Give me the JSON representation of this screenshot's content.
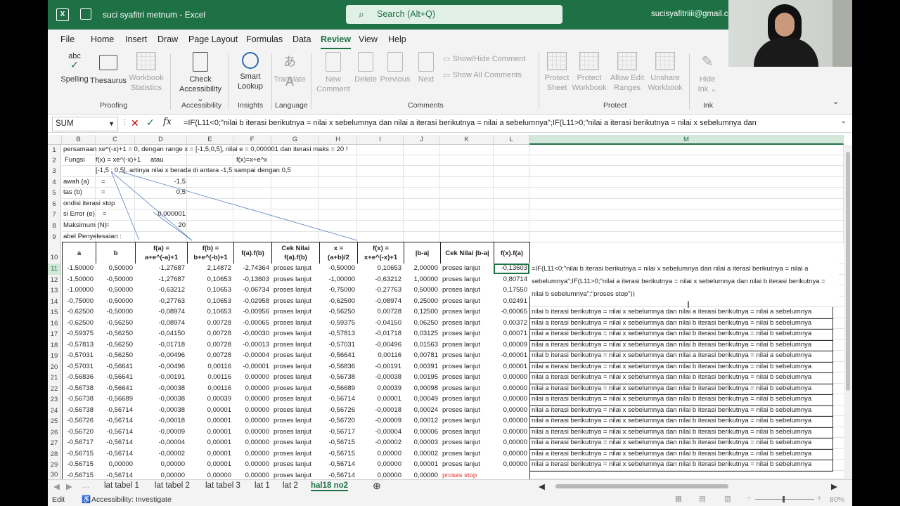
{
  "title_bar": {
    "doc_title": "suci syafitri metnum  -  Excel",
    "search_placeholder": "Search (Alt+Q)",
    "user": "sucisyafitriiii@gmail.com"
  },
  "menu": {
    "tabs": [
      "File",
      "Home",
      "Insert",
      "Draw",
      "Page Layout",
      "Formulas",
      "Data",
      "Review",
      "View",
      "Help"
    ],
    "active": "Review"
  },
  "ribbon": {
    "spelling": "Spelling",
    "thesaurus": "Thesaurus",
    "workbook_stats_1": "Workbook",
    "workbook_stats_2": "Statistics",
    "proofing": "Proofing",
    "check_acc_1": "Check",
    "check_acc_2": "Accessibility ⌄",
    "accessibility": "Accessibility",
    "smart_1": "Smart",
    "smart_2": "Lookup",
    "insights": "Insights",
    "translate": "Translate",
    "language": "Language",
    "new_1": "New",
    "new_2": "Comment",
    "delete": "Delete",
    "previous": "Previous",
    "next": "Next",
    "show_hide": "Show/Hide Comment",
    "show_all": "Show All Comments",
    "comments": "Comments",
    "protect_sheet_1": "Protect",
    "protect_sheet_2": "Sheet",
    "protect_wb_1": "Protect",
    "protect_wb_2": "Workbook",
    "allow_1": "Allow Edit",
    "allow_2": "Ranges",
    "unshare_1": "Unshare",
    "unshare_2": "Workbook",
    "protect": "Protect",
    "hide_ink_1": "Hide",
    "hide_ink_2": "Ink ⌄",
    "ink": "Ink"
  },
  "formula_bar": {
    "name_box": "SUM",
    "formula": "=IF(L11<0;\"nilai b iterasi berikutnya = nilai x sebelumnya dan nilai a iterasi berikutnya = nilai a sebelumnya\";IF(L11>0;\"nilai a iterasi berikutnya = nilai x sebelumnya dan"
  },
  "columns": [
    "B",
    "C",
    "D",
    "E",
    "F",
    "G",
    "H",
    "I",
    "J",
    "K",
    "L",
    "M"
  ],
  "rows": [
    "1",
    "2",
    "3",
    "4",
    "5",
    "6",
    "7",
    "8",
    "9",
    "10",
    "11",
    "12",
    "13",
    "14",
    "15",
    "16",
    "17",
    "18",
    "19",
    "20",
    "21",
    "22",
    "23",
    "24",
    "25",
    "26",
    "27",
    "28",
    "29",
    "30"
  ],
  "top_text": {
    "r1": "persamaan xe^(-x)+1 = 0, dengan range x = [-1,5;0,5], nilai e = 0,000001 dan iterasi maks = 20 !",
    "r2_a": "Fungsi",
    "r2_b": "f(x) = xe^(-x)+1",
    "r2_c": "atau",
    "r2_d": "f(x)=x+e^x",
    "r3": "[-1,5 ; 0,5], artinya nilai x berada di antara -1,5 sampai dengan 0,5",
    "r4_a": "awah (a)",
    "r4_b": "=",
    "r4_c": "-1,5",
    "r5_a": "tas (b)",
    "r5_b": "=",
    "r5_c": "0,5",
    "r6": "ondisi iterasi stop",
    "r7_a": "si Error (e)",
    "r7_b": "=",
    "r7_c": "0,000001",
    "r8_a": "Maksimum (N)",
    "r8_b": "=",
    "r8_c": "20",
    "r9": "abel Penyelesaian :"
  },
  "table_headers": [
    {
      "l1": "a",
      "l2": ""
    },
    {
      "l1": "b",
      "l2": ""
    },
    {
      "l1": "f(a) =",
      "l2": "a+e^(-a)+1"
    },
    {
      "l1": "f(b) =",
      "l2": "b+e^(-b)+1"
    },
    {
      "l1": "f(a).f(b)",
      "l2": ""
    },
    {
      "l1": "Cek Nilai",
      "l2": "f(a).f(b)"
    },
    {
      "l1": "x =",
      "l2": "(a+b)/2"
    },
    {
      "l1": "f(x) =",
      "l2": "x+e^(-x)+1"
    },
    {
      "l1": "|b-a|",
      "l2": ""
    },
    {
      "l1": "Cek Nilai |b-a|",
      "l2": ""
    },
    {
      "l1": "f(x).f(a)",
      "l2": ""
    }
  ],
  "table_rows": [
    [
      "-1,50000",
      "0,50000",
      "-1,27687",
      "2,14872",
      "-2,74364",
      "proses lanjut",
      "-0,50000",
      "0,10653",
      "2,00000",
      "proses lanjut",
      "-0,13603"
    ],
    [
      "-1,50000",
      "-0,50000",
      "-1,27687",
      "0,10653",
      "-0,13603",
      "proses lanjut",
      "-1,00000",
      "-0,63212",
      "1,00000",
      "proses lanjut",
      "0,80714"
    ],
    [
      "-1,00000",
      "-0,50000",
      "-0,63212",
      "0,10653",
      "-0,06734",
      "proses lanjut",
      "-0,75000",
      "-0,27763",
      "0,50000",
      "proses lanjut",
      "0,17550"
    ],
    [
      "-0,75000",
      "-0,50000",
      "-0,27763",
      "0,10653",
      "-0,02958",
      "proses lanjut",
      "-0,62500",
      "-0,08974",
      "0,25000",
      "proses lanjut",
      "0,02491"
    ],
    [
      "-0,62500",
      "-0,50000",
      "-0,08974",
      "0,10653",
      "-0,00956",
      "proses lanjut",
      "-0,56250",
      "0,00728",
      "0,12500",
      "proses lanjut",
      "-0,00065"
    ],
    [
      "-0,62500",
      "-0,56250",
      "-0,08974",
      "0,00728",
      "-0,00065",
      "proses lanjut",
      "-0,59375",
      "-0,04150",
      "0,06250",
      "proses lanjut",
      "0,00372"
    ],
    [
      "-0,59375",
      "-0,56250",
      "-0,04150",
      "0,00728",
      "-0,00030",
      "proses lanjut",
      "-0,57813",
      "-0,01718",
      "0,03125",
      "proses lanjut",
      "0,00071"
    ],
    [
      "-0,57813",
      "-0,56250",
      "-0,01718",
      "0,00728",
      "-0,00013",
      "proses lanjut",
      "-0,57031",
      "-0,00496",
      "0,01563",
      "proses lanjut",
      "0,00009"
    ],
    [
      "-0,57031",
      "-0,56250",
      "-0,00496",
      "0,00728",
      "-0,00004",
      "proses lanjut",
      "-0,56641",
      "0,00116",
      "0,00781",
      "proses lanjut",
      "-0,00001"
    ],
    [
      "-0,57031",
      "-0,56641",
      "-0,00496",
      "0,00116",
      "-0,00001",
      "proses lanjut",
      "-0,56836",
      "-0,00191",
      "0,00391",
      "proses lanjut",
      "0,00001"
    ],
    [
      "-0,56836",
      "-0,56641",
      "-0,00191",
      "0,00116",
      "0,00000",
      "proses lanjut",
      "-0,56738",
      "-0,00038",
      "0,00195",
      "proses lanjut",
      "0,00000"
    ],
    [
      "-0,56738",
      "-0,56641",
      "-0,00038",
      "0,00116",
      "0,00000",
      "proses lanjut",
      "-0,56689",
      "0,00039",
      "0,00098",
      "proses lanjut",
      "0,00000"
    ],
    [
      "-0,56738",
      "-0,56689",
      "-0,00038",
      "0,00039",
      "0,00000",
      "proses lanjut",
      "-0,56714",
      "0,00001",
      "0,00049",
      "proses lanjut",
      "0,00000"
    ],
    [
      "-0,56738",
      "-0,56714",
      "-0,00038",
      "0,00001",
      "0,00000",
      "proses lanjut",
      "-0,56726",
      "-0,00018",
      "0,00024",
      "proses lanjut",
      "0,00000"
    ],
    [
      "-0,56726",
      "-0,56714",
      "-0,00018",
      "0,00001",
      "0,00000",
      "proses lanjut",
      "-0,56720",
      "-0,00009",
      "0,00012",
      "proses lanjut",
      "0,00000"
    ],
    [
      "-0,56720",
      "-0,56714",
      "-0,00009",
      "0,00001",
      "0,00000",
      "proses lanjut",
      "-0,56717",
      "-0,00004",
      "0,00006",
      "proses lanjut",
      "0,00000"
    ],
    [
      "-0,56717",
      "-0,56714",
      "-0,00004",
      "0,00001",
      "0,00000",
      "proses lanjut",
      "-0,56715",
      "-0,00002",
      "0,00003",
      "proses lanjut",
      "0,00000"
    ],
    [
      "-0,56715",
      "-0,56714",
      "-0,00002",
      "0,00001",
      "0,00000",
      "proses lanjut",
      "-0,56715",
      "0,00000",
      "0,00002",
      "proses lanjut",
      "0,00000"
    ],
    [
      "-0,56715",
      "0,00000",
      "0,00000",
      "0,00001",
      "0,00000",
      "proses lanjut",
      "-0,56714",
      "0,00000",
      "0,00001",
      "proses lanjut",
      "0,00000"
    ],
    [
      "-0,56715",
      "-0,56714",
      "0,00000",
      "0,00000",
      "0,00000",
      "proses lanjut",
      "-0,56714",
      "0,00000",
      "0,00000",
      "proses stop",
      ""
    ]
  ],
  "m_column": {
    "edit_l1": "=IF(L11<0;\"nilai b iterasi berikutnya = nilai x sebelumnya dan nilai a iterasi berikutnya = nilai a",
    "edit_l2": "sebelumnya\";IF(L11>0;\"nilai a iterasi berikutnya = nilai x sebelumnya dan nilai b iterasi berikutnya =",
    "edit_l3": "nilai b sebelumnya\";\"proses stop\"))",
    "rows": [
      "nilai b iterasi berikutnya = nilai x sebelumnya dan nilai a iterasi berikutnya = nilai a sebelumnya",
      "nilai a iterasi berikutnya = nilai x sebelumnya dan nilai b iterasi berikutnya = nilai b sebelumnya",
      "nilai a iterasi berikutnya = nilai x sebelumnya dan nilai b iterasi berikutnya = nilai b sebelumnya",
      "nilai a iterasi berikutnya = nilai x sebelumnya dan nilai b iterasi berikutnya = nilai b sebelumnya",
      "nilai b iterasi berikutnya = nilai x sebelumnya dan nilai a iterasi berikutnya = nilai a sebelumnya",
      "nilai a iterasi berikutnya = nilai x sebelumnya dan nilai b iterasi berikutnya = nilai b sebelumnya",
      "nilai a iterasi berikutnya = nilai x sebelumnya dan nilai b iterasi berikutnya = nilai b sebelumnya",
      "nilai a iterasi berikutnya = nilai x sebelumnya dan nilai b iterasi berikutnya = nilai b sebelumnya",
      "nilai a iterasi berikutnya = nilai x sebelumnya dan nilai b iterasi berikutnya = nilai b sebelumnya",
      "nilai a iterasi berikutnya = nilai x sebelumnya dan nilai b iterasi berikutnya = nilai b sebelumnya",
      "nilai a iterasi berikutnya = nilai x sebelumnya dan nilai b iterasi berikutnya = nilai b sebelumnya",
      "nilai a iterasi berikutnya = nilai x sebelumnya dan nilai b iterasi berikutnya = nilai b sebelumnya",
      "nilai a iterasi berikutnya = nilai x sebelumnya dan nilai b iterasi berikutnya = nilai b sebelumnya",
      "nilai a iterasi berikutnya = nilai x sebelumnya dan nilai b iterasi berikutnya = nilai b sebelumnya",
      "nilai a iterasi berikutnya = nilai x sebelumnya dan nilai b iterasi berikutnya = nilai b sebelumnya"
    ]
  },
  "sheet_tabs": [
    "lat tabel 1",
    "lat tabel 2",
    "lat tabel 3",
    "lat 1",
    "lat 2",
    "hal18 no2"
  ],
  "active_sheet": "hal18 no2",
  "status": {
    "mode": "Edit",
    "accessibility": "Accessibility: Investigate",
    "zoom": "80%"
  },
  "colors": {
    "excel_green": "#1e7145",
    "proses_stop": "#e03030"
  }
}
